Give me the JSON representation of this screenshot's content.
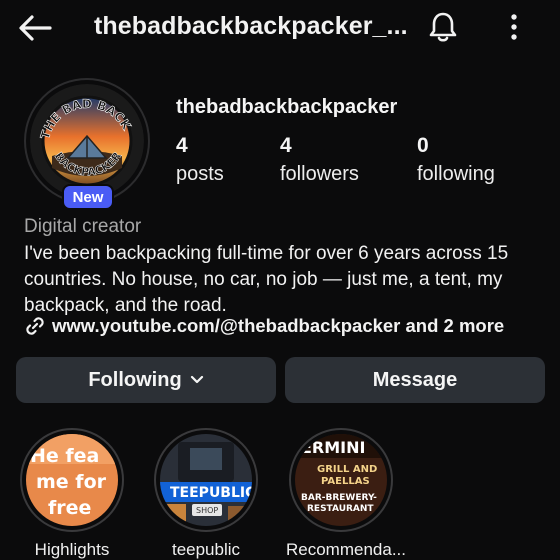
{
  "header": {
    "title": "thebadbackbackpacker_...",
    "back_icon": "arrow-left-icon",
    "bell_icon": "bell-icon",
    "more_icon": "more-vertical-icon"
  },
  "profile": {
    "avatar_text_top": "THE BAD BACK",
    "avatar_text_bottom": "BACKPACKER",
    "badge": "New",
    "username": "thebadbackbackpacker",
    "stats": [
      {
        "num": "4",
        "label": "posts"
      },
      {
        "num": "4",
        "label": "followers"
      },
      {
        "num": "0",
        "label": "following"
      }
    ],
    "category": "Digital creator",
    "bio": "I've been backpacking full-time for over 6 years across 15 countries. No house, no car, no job — just me, a tent, my backpack, and the road.",
    "link_icon": "link-icon",
    "link": "www.youtube.com/@thebadbackpacker and 2 more"
  },
  "actions": {
    "following_label": "Following",
    "message_label": "Message"
  },
  "highlights": [
    {
      "label": "Highlights",
      "cover_text": [
        "He fea",
        "me for",
        "free"
      ]
    },
    {
      "label": "teepublic",
      "cover_text": [
        "TEEPUBLIC",
        "SHOP"
      ]
    },
    {
      "label": "Recommenda...",
      "cover_text": [
        "ERMINI",
        "GRILL AND",
        "PAELLAS",
        "BAR-BREWERY-",
        "RESTAURANT"
      ]
    }
  ],
  "colors": {
    "background": "#0b0b0c",
    "button": "#2c3036",
    "badge": "#4a5cf5",
    "muted_text": "#a8a8a8"
  }
}
